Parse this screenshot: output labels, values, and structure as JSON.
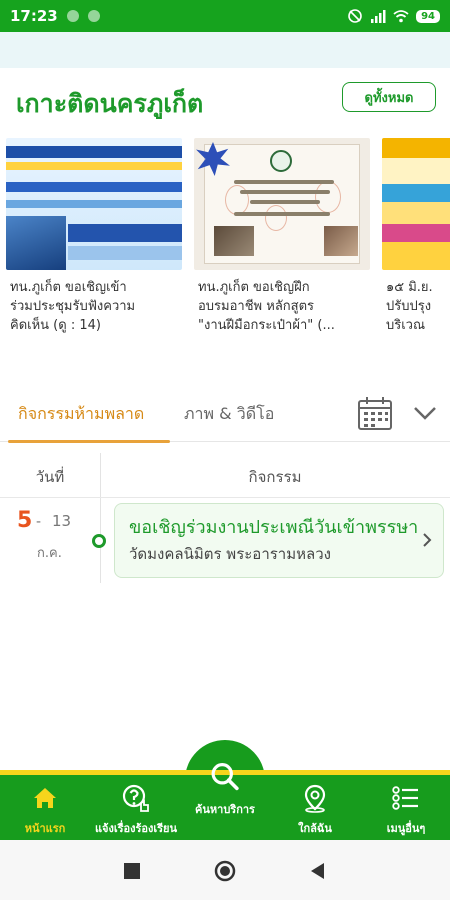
{
  "status_bar": {
    "time": "17:23",
    "battery": "94"
  },
  "news": {
    "title": "เกาะติดนครภูเก็ต",
    "see_all": "ดูทั้งหมด",
    "cards": [
      {
        "lines": [
          "ทน.ภูเก็ต ขอเชิญเข้า",
          "ร่วมประชุมรับฟังความ",
          "คิดเห็น (ดู : 14)"
        ]
      },
      {
        "lines": [
          "ทน.ภูเก็ต ขอเชิญฝึก",
          "อบรมอาชีพ หลักสูตร",
          "\"งานฝีมือกระเป๋าผ้า\" (..."
        ]
      },
      {
        "lines": [
          "๑๕ มิ.ย.",
          "ปรับปรุง",
          "บริเวณ"
        ]
      }
    ]
  },
  "tabs": {
    "active": "กิจกรรมห้ามพลาด",
    "media": "ภาพ & วิดีโอ"
  },
  "table": {
    "col_date": "วันที่",
    "col_activity": "กิจกรรม",
    "rows": [
      {
        "day": "5",
        "dash": "-",
        "day_end": "13",
        "month": "ก.ค.",
        "title": "ขอเชิญร่วมงานประเพณีวันเข้าพรรษา",
        "place": "วัดมงคลนิมิตร พระอารามหลวง"
      }
    ]
  },
  "bottom_nav": {
    "home": "หน้าแรก",
    "report": "แจ้งเรื่องร้องเรียน",
    "search": "ค้นหาบริการ",
    "nearby": "ใกล้ฉัน",
    "more": "เมนูอื่นๆ"
  },
  "colors": {
    "primary_green": "#179c1d",
    "accent_yellow": "#f6d51c",
    "tab_orange": "#d68a17",
    "date_orange": "#e8541e"
  }
}
